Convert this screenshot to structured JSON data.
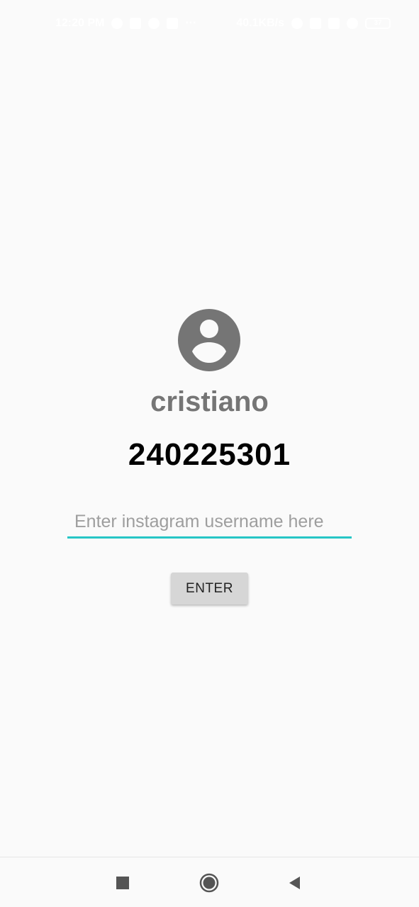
{
  "status_bar": {
    "time": "12:20 PM",
    "network_speed": "40.1KB/s",
    "battery": "37"
  },
  "profile": {
    "icon": "account-circle-icon",
    "username": "cristiano",
    "follower_count": "240225301"
  },
  "form": {
    "input_placeholder": "Enter instagram username here",
    "input_value": "",
    "enter_label": "ENTER"
  },
  "nav": {
    "recent_icon": "square-icon",
    "home_icon": "circle-icon",
    "back_icon": "triangle-back-icon"
  },
  "colors": {
    "background": "#fafafa",
    "accent": "#26c6c6",
    "avatar": "#757575",
    "button": "#d6d6d6"
  }
}
